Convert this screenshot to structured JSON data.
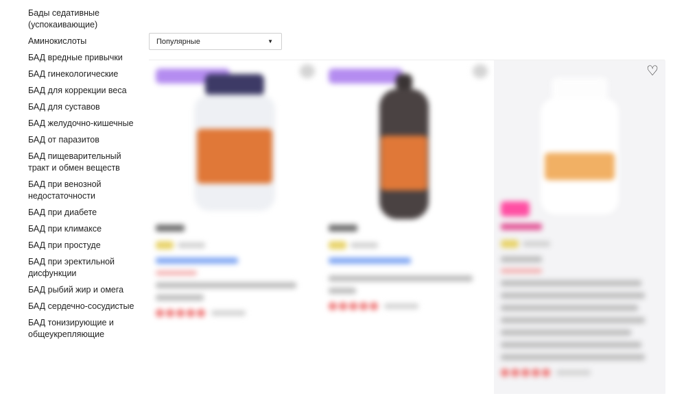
{
  "sidebar": {
    "categories": [
      "Бады седативные (успокаивающие)",
      "Аминокислоты",
      "БАД вредные привычки",
      "БАД гинекологические",
      "БАД для коррекции веса",
      "БАД для суставов",
      "БАД желудочно-кишечные",
      "БАД от паразитов",
      "БАД пищеварительный тракт и обмен веществ",
      "БАД при венозной недостаточности",
      "БАД при диабете",
      "БАД при климаксе",
      "БАД при простуде",
      "БАД при эректильной дисфункции",
      "БАД рыбий жир и омега",
      "БАД сердечно-сосудистые",
      "БАД тонизирующие и общеукрепляющие"
    ]
  },
  "sort": {
    "selected": "Популярные",
    "caret_icon": "caret-down-icon"
  },
  "products": {
    "favorite_icon": "heart-icon",
    "favorite_glyph": "♡",
    "colors": {
      "badge_purple": "#b48cf0",
      "sale_pink": "#ff4fa3",
      "rating_red": "#ef7c7c",
      "stock_yellow": "#e8d36a",
      "seller_blue": "#7ea5f3"
    }
  }
}
